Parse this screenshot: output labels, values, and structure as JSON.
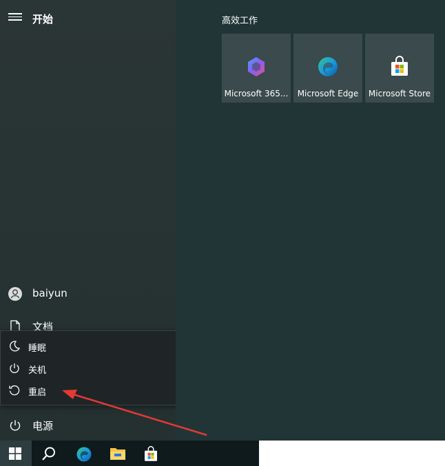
{
  "start": {
    "title": "开始"
  },
  "group": {
    "title": "高效工作"
  },
  "tiles": [
    {
      "label": "Microsoft 365...",
      "icon": "microsoft-365-icon"
    },
    {
      "label": "Microsoft Edge",
      "icon": "edge-icon"
    },
    {
      "label": "Microsoft Store",
      "icon": "store-icon"
    }
  ],
  "sidebar": {
    "user": "baiyun",
    "documents": "文档",
    "power": "电源"
  },
  "power_menu": {
    "sleep": "睡眠",
    "shutdown": "关机",
    "restart": "重启"
  },
  "colors": {
    "annotation_arrow": "#e53935",
    "left_panel": "#2a3535",
    "right_panel": "#213537",
    "tile": "#3a4a4d"
  }
}
